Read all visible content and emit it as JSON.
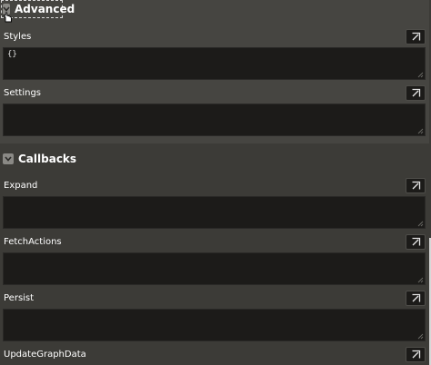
{
  "sections": {
    "advanced": {
      "title": "Advanced",
      "fields": [
        {
          "label": "Styles",
          "value": "{}"
        },
        {
          "label": "Settings",
          "value": ""
        }
      ]
    },
    "callbacks": {
      "title": "Callbacks",
      "fields": [
        {
          "label": "Expand",
          "value": ""
        },
        {
          "label": "FetchActions",
          "value": ""
        },
        {
          "label": "Persist",
          "value": ""
        },
        {
          "label": "UpdateGraphData",
          "value": ""
        }
      ]
    }
  },
  "icons": {
    "expand_editor": "open-external-icon",
    "collapse": "chevron-down-icon",
    "cursor": "hand-cursor-icon"
  },
  "colors": {
    "panel_bg": "#3c3b37",
    "section_bg": "#464541",
    "field_bg": "#1c1b19",
    "text": "#ffffff"
  }
}
